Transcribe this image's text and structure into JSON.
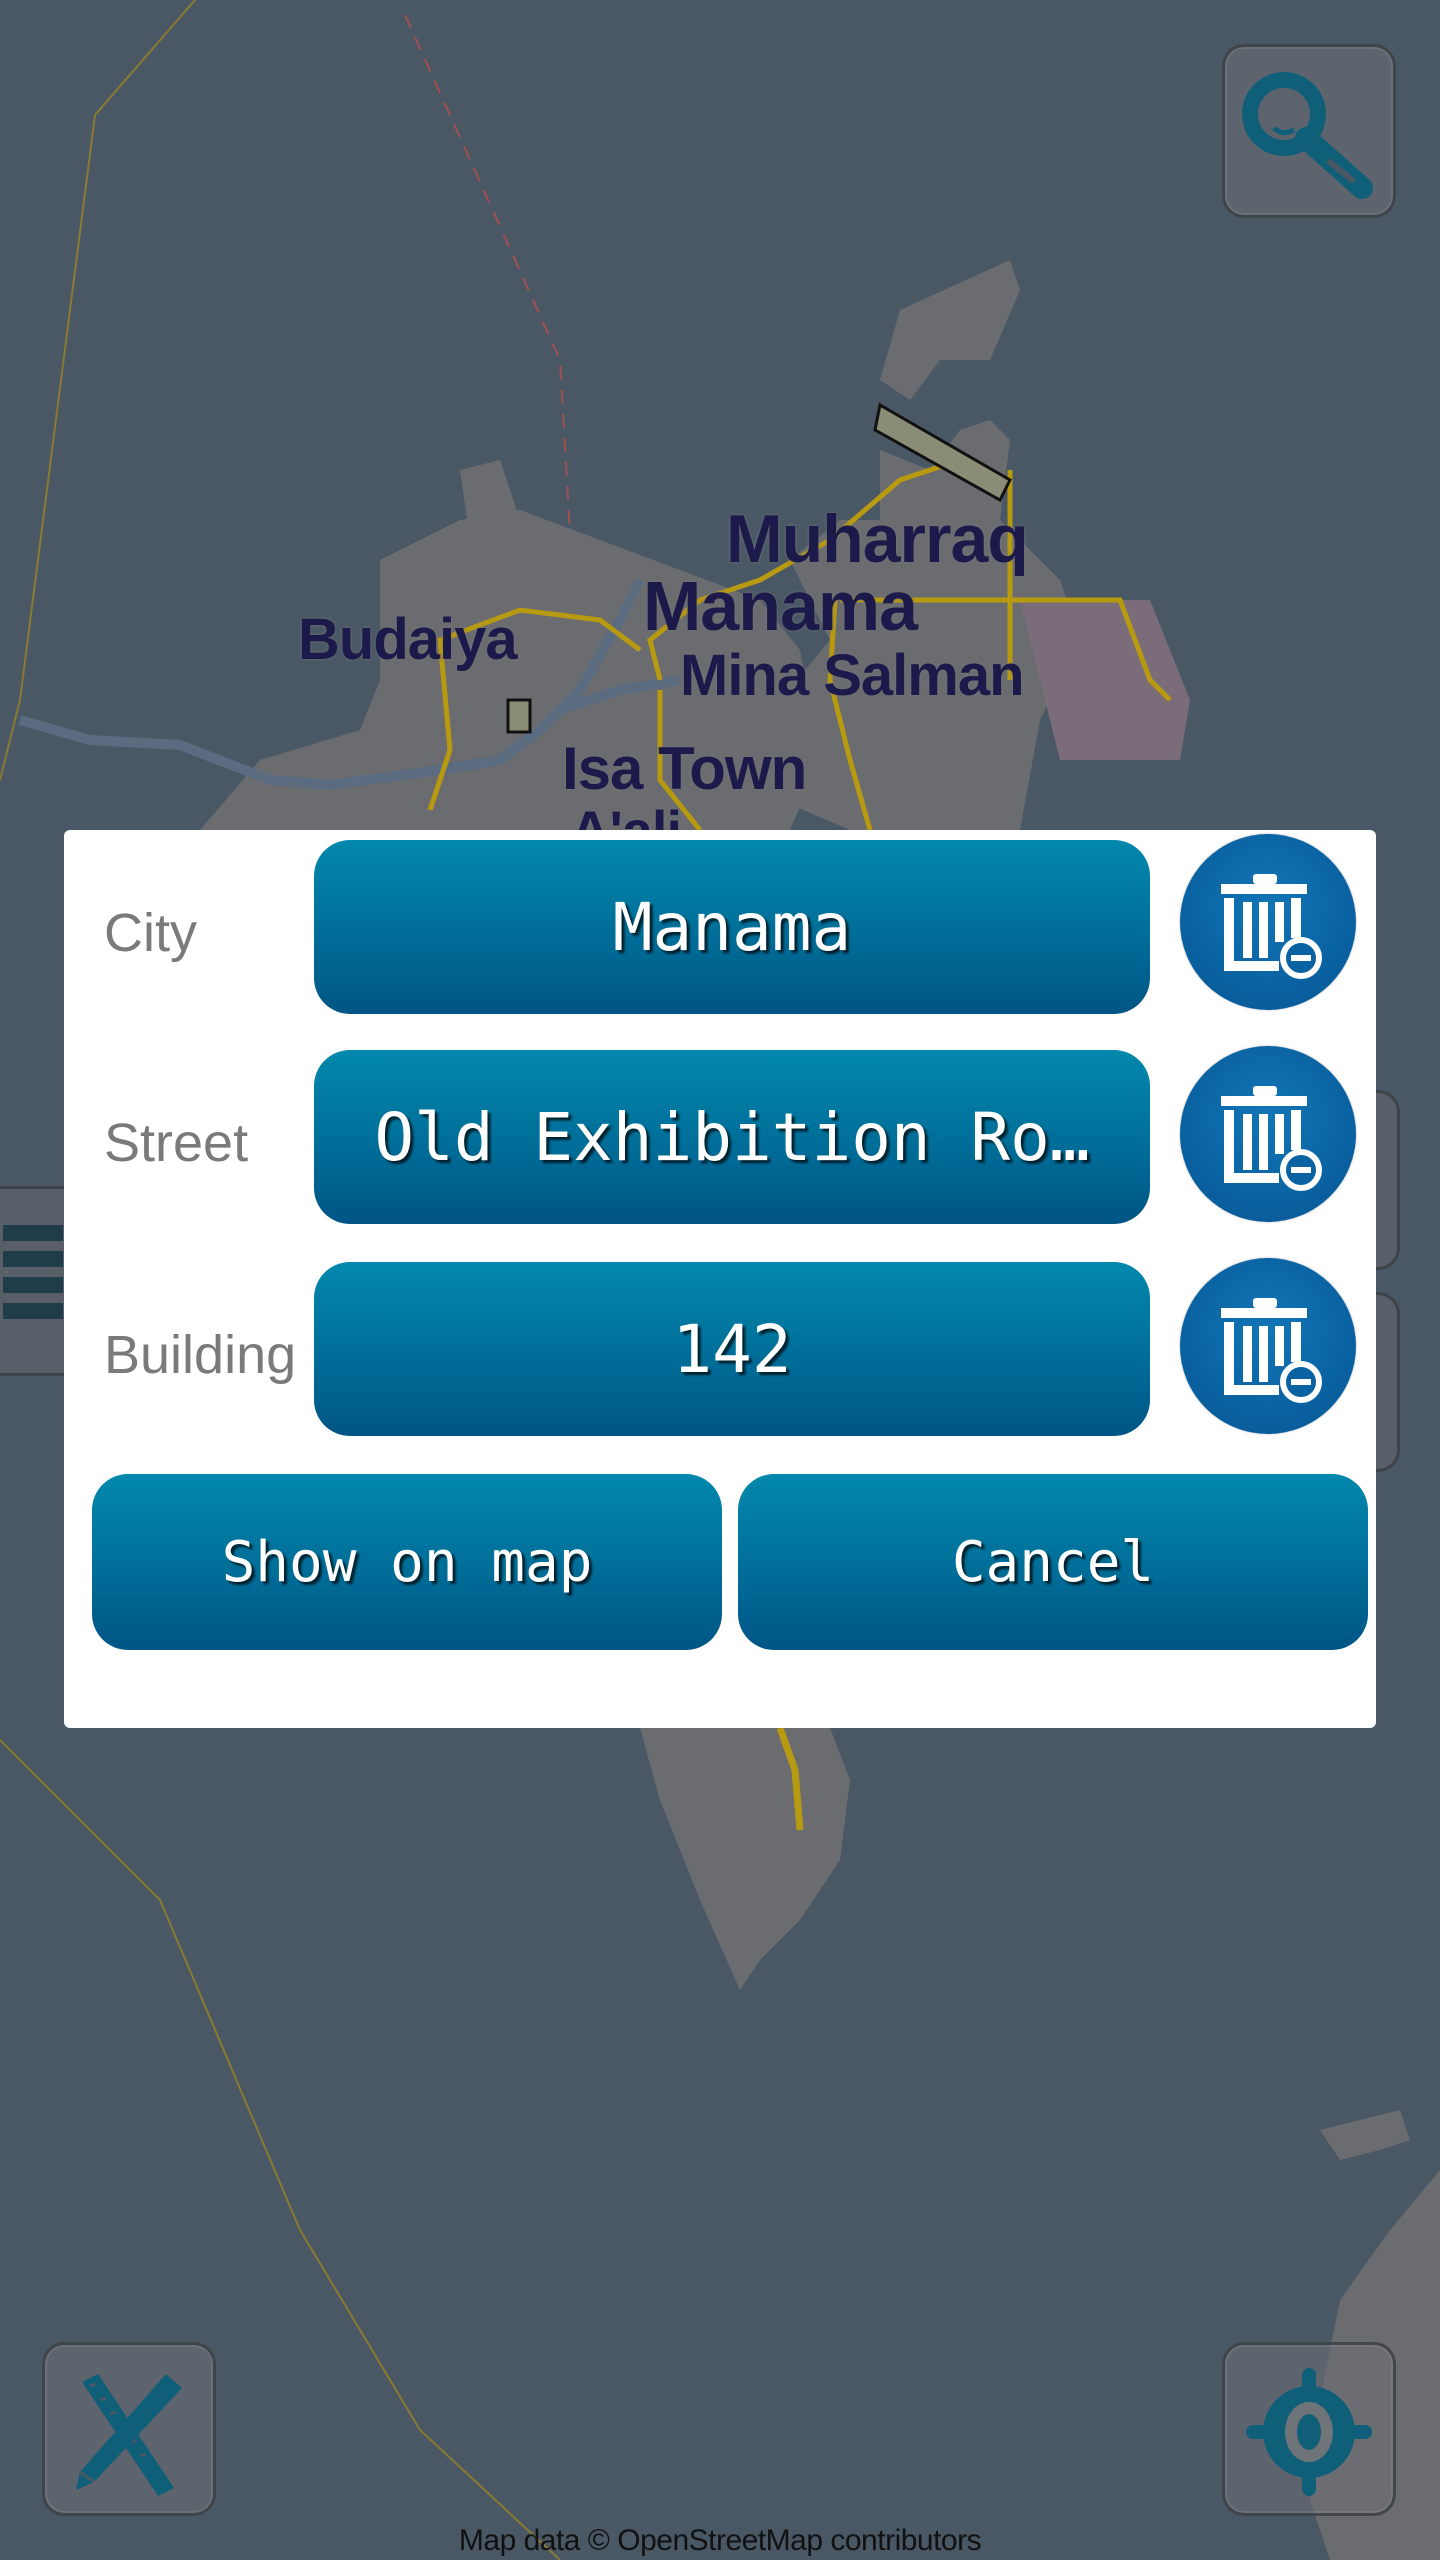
{
  "map": {
    "labels": {
      "muharraq": "Muharraq",
      "manama": "Manama",
      "budaiya": "Budaiya",
      "mina_salman": "Mina Salman",
      "isa_town": "Isa Town",
      "aali": "A'ali"
    },
    "attribution": "Map data © OpenStreetMap contributors",
    "colors": {
      "water": "#4a5866",
      "land": "#6b6c70",
      "road": "#b89a10",
      "label": "#1c1a4a"
    }
  },
  "controls": {
    "search_icon": "search-icon",
    "ruler_icon": "ruler-pencil-icon",
    "locate_icon": "crosshair-locate-icon"
  },
  "dialog": {
    "rows": [
      {
        "label": "City",
        "value": "Manama",
        "clear_icon": "trash-minus-icon"
      },
      {
        "label": "Street",
        "value": "Old Exhibition Ro…",
        "clear_icon": "trash-minus-icon"
      },
      {
        "label": "Building",
        "value": "142",
        "clear_icon": "trash-minus-icon"
      }
    ],
    "show_on_map_label": "Show on map",
    "cancel_label": "Cancel",
    "accent_color": "#00709a"
  }
}
